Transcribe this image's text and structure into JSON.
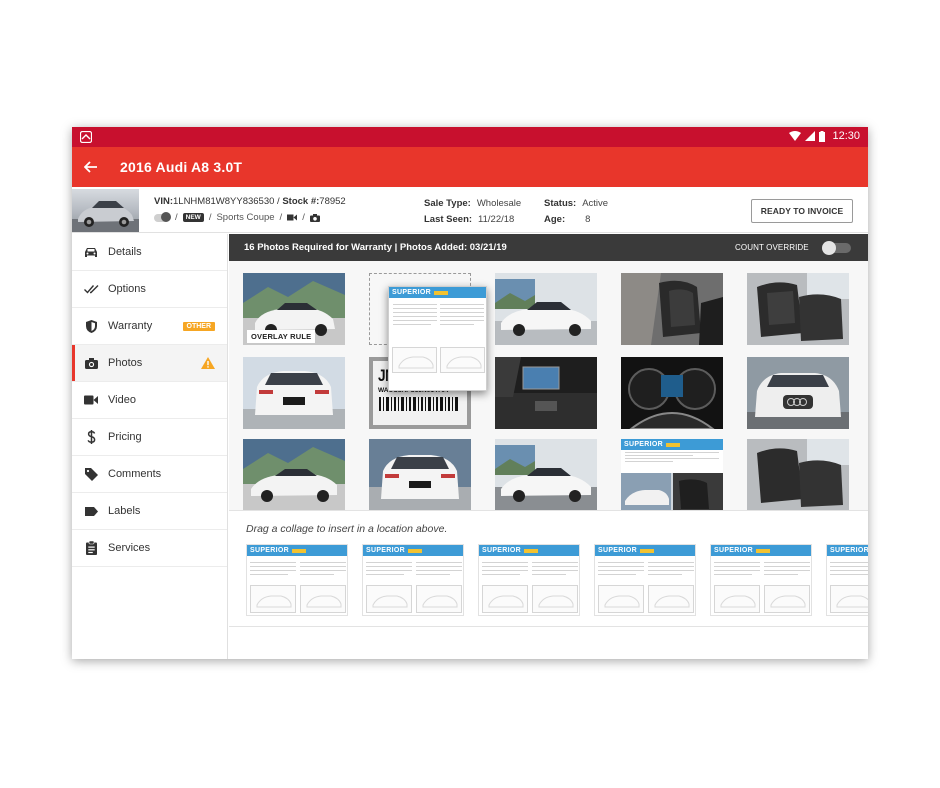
{
  "status_bar": {
    "time": "12:30"
  },
  "app_bar": {
    "title": "2016 Audi A8 3.0T"
  },
  "vehicle": {
    "vin_label": "VIN:",
    "vin": "1LNHM81W8YY836530",
    "stock_label": "Stock #:",
    "stock": "78952",
    "separator": "/",
    "new_badge": "NEW",
    "body_style": "Sports Coupe",
    "sale_type_label": "Sale Type:",
    "sale_type": "Wholesale",
    "last_seen_label": "Last Seen:",
    "last_seen": "11/22/18",
    "status_label": "Status:",
    "status": "Active",
    "age_label": "Age:",
    "age": "8",
    "ready_button": "READY TO INVOICE"
  },
  "sidebar": {
    "items": [
      {
        "label": "Details",
        "icon": "car-icon"
      },
      {
        "label": "Options",
        "icon": "double-check-icon"
      },
      {
        "label": "Warranty",
        "icon": "shield-icon",
        "badge": "OTHER"
      },
      {
        "label": "Photos",
        "icon": "camera-icon",
        "active": true,
        "alert": "warning-icon"
      },
      {
        "label": "Video",
        "icon": "video-icon"
      },
      {
        "label": "Pricing",
        "icon": "dollar-icon"
      },
      {
        "label": "Comments",
        "icon": "tag-icon"
      },
      {
        "label": "Labels",
        "icon": "label-icon"
      },
      {
        "label": "Services",
        "icon": "clipboard-icon"
      }
    ]
  },
  "photos": {
    "header": "16 Photos Required for Warranty | Photos Added: 03/21/19",
    "count_override": "COUNT OVERRIDE",
    "overlay_label": "OVERLAY RULE",
    "tag_text": "JN014764",
    "barcode_text": "WAUC8AFC3JN014764"
  },
  "collage": {
    "brand": "SUPERIOR"
  },
  "tray": {
    "hint": "Drag a collage to insert in a location above."
  },
  "colors": {
    "accent": "#e8362b",
    "status_bar": "#c8102e",
    "collage_header": "#3d9bd6",
    "badge": "#f6a623"
  }
}
